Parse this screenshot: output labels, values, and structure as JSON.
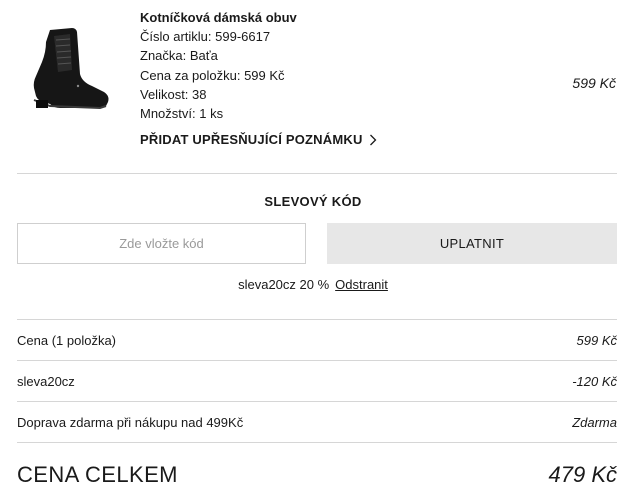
{
  "product": {
    "name": "Kotníčková dámská obuv",
    "article": "Číslo artiklu: 599-6617",
    "brand": "Značka: Baťa",
    "unit_price": "Cena za položku: 599 Kč",
    "size": "Velikost: 38",
    "quantity": "Množství: 1 ks",
    "add_note": "PŘIDAT UPŘESŇUJÍCÍ POZNÁMKU",
    "price": "599 Kč",
    "image_icon": "black-ankle-boot-image"
  },
  "discount": {
    "title": "SLEVOVÝ KÓD",
    "placeholder": "Zde vložte kód",
    "apply_label": "UPLATNIT",
    "applied_code": "sleva20cz 20 %",
    "remove_label": "Odstranit"
  },
  "summary": {
    "rows": [
      {
        "label": "Cena (1 položka)",
        "value": "599 Kč"
      },
      {
        "label": "sleva20cz",
        "value": "-120 Kč"
      },
      {
        "label": "Doprava zdarma při nákupu nad 499Kč",
        "value": "Zdarma"
      }
    ],
    "total_label": "CENA CELKEM",
    "total_value": "479 Kč"
  }
}
